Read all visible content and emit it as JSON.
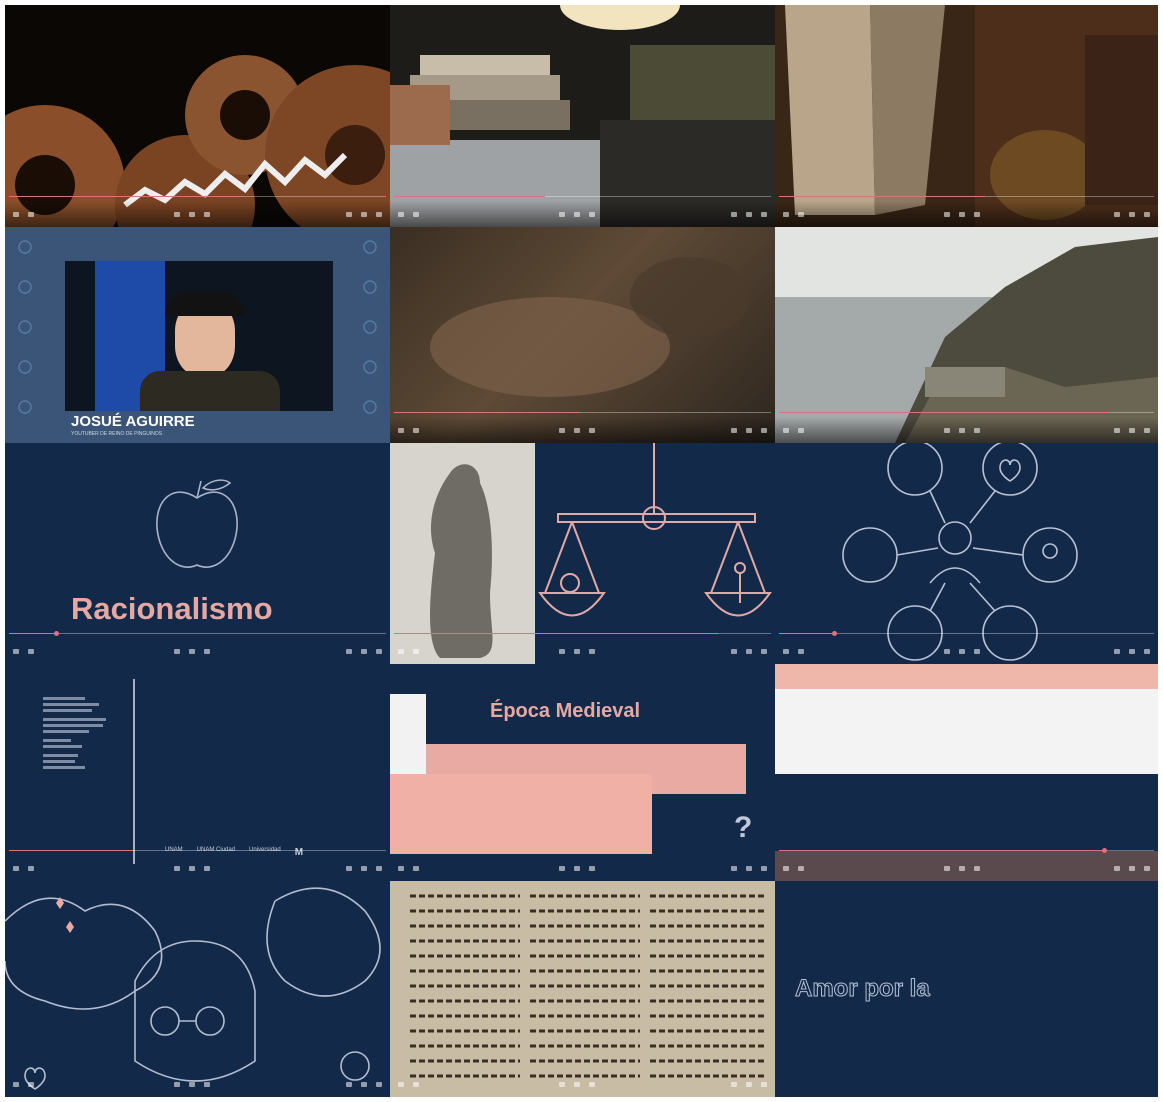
{
  "tiles": [
    {
      "id": "gears",
      "progress": 0.62
    },
    {
      "id": "desk-books",
      "progress": 0.4
    },
    {
      "id": "old-book",
      "progress": 0.55
    },
    {
      "id": "presenter",
      "name": "JOSUÉ AGUIRRE",
      "subtitle": "YOUTUBER DE REINO DE PINGUINOS",
      "progress": 0.0
    },
    {
      "id": "blurred-hand",
      "progress": 0.49
    },
    {
      "id": "coast-ruins",
      "progress": 0.88
    },
    {
      "id": "racionalismo",
      "title": "Racionalismo",
      "progress": 0.12
    },
    {
      "id": "philosopher-scale",
      "progress": 0.86
    },
    {
      "id": "person-connections",
      "progress": 0.14
    },
    {
      "id": "credits",
      "logos": [
        "UNAM",
        "UNAM Ciudad",
        "Universidad",
        "M"
      ],
      "progress": 0.33
    },
    {
      "id": "epoca-medieval",
      "title": "Época Medieval",
      "progress": 0.0
    },
    {
      "id": "white-band",
      "progress": 0.86
    },
    {
      "id": "thinking-person",
      "progress": 0.0
    },
    {
      "id": "manuscript",
      "progress": 0.0
    },
    {
      "id": "amor",
      "title": "Amor por la",
      "progress": 0.0
    }
  ],
  "colors": {
    "navy": "#12294a",
    "pink": "#e6a9a2",
    "accent": "#e0707f"
  }
}
